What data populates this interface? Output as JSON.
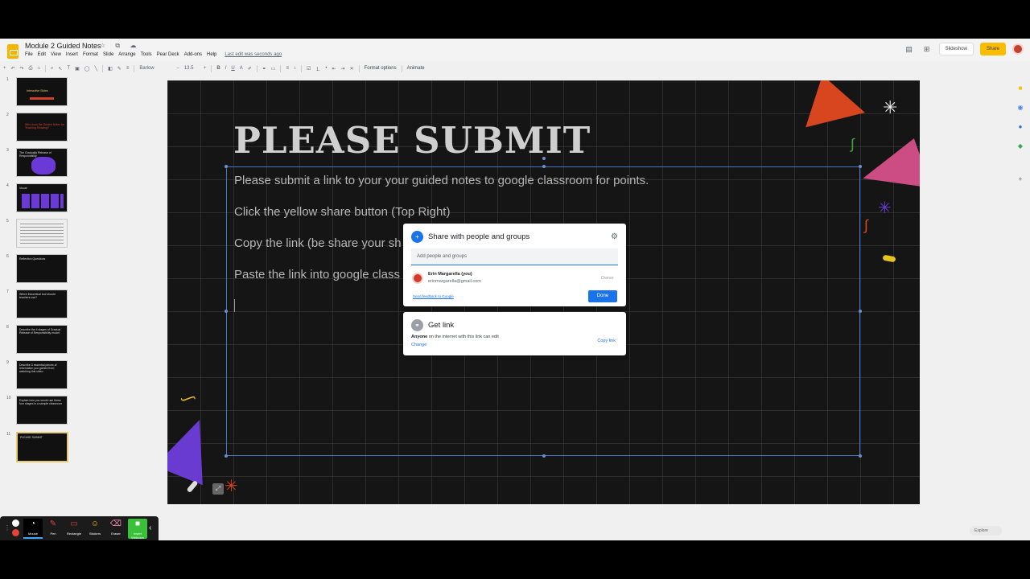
{
  "titlebar": {
    "doc_title": "Module 2 Guided Notes",
    "title_icons": "☆ ⧉ ☁",
    "menu": [
      "File",
      "Edit",
      "View",
      "Insert",
      "Format",
      "Slide",
      "Arrange",
      "Tools",
      "Pear Deck",
      "Add-ons",
      "Help"
    ],
    "last_edit": "Last edit was seconds ago",
    "slideshow_label": "Slideshow",
    "share_label": "Share"
  },
  "toolbar": {
    "font": "Barlow",
    "font_size": "13.5",
    "format_options": "Format options",
    "animate": "Animate"
  },
  "filmstrip": {
    "numbers": [
      "1",
      "2",
      "3",
      "4",
      "5",
      "6",
      "7",
      "8",
      "9",
      "10",
      "11"
    ],
    "titles": [
      "Interactive Slides",
      "Who does the Guided Notes for Teaching Reading?",
      "The Gradually Release of Responsibility",
      "Visual",
      "",
      "Reflection Questions",
      "Which theoretical tool should teachers use?",
      "Describe the 4 stages of Gradual Release of Responsibility model",
      "Describe 3 essential pieces of information you gained from watching this video",
      "Explain how you would use these four stages in a sample classroom",
      "PLEASE SUBMIT"
    ]
  },
  "slide": {
    "title": "PLEASE SUBMIT",
    "lines": [
      "Please submit a link to your your guided notes to google classroom for points.",
      "Click the yellow share button (Top Right)",
      "Copy the link (be share your sh",
      "Paste the link into google class"
    ]
  },
  "share_dialog": {
    "heading": "Share with people and groups",
    "input_placeholder": "Add people and groups",
    "user_name": "Erin Margarella (you)",
    "user_email": "erinmargarella@gmail.com",
    "role": "Owner",
    "feedback": "Send feedback to Google",
    "done": "Done"
  },
  "get_link": {
    "heading": "Get link",
    "access_bold": "Anyone",
    "access_rest": " on the internet with this link can edit",
    "change": "Change",
    "copy": "Copy link"
  },
  "explore_label": "Explore",
  "annotation_tools": [
    {
      "label": "Mouse",
      "icon": "◔"
    },
    {
      "label": "Pen",
      "icon": "✎"
    },
    {
      "label": "Rectangle",
      "icon": "▭"
    },
    {
      "label": "Stickers",
      "icon": "☺"
    },
    {
      "label": "Eraser",
      "icon": "⌫"
    },
    {
      "label": "Insert Webcam",
      "icon": "■"
    }
  ],
  "colors": {
    "share_yellow": "#fbbc04",
    "accent_blue": "#1a73e8",
    "slide_bg": "#151515",
    "shape_orange": "#d8461f",
    "shape_pink": "#cc4d84",
    "shape_purple": "#6a3bd1"
  }
}
